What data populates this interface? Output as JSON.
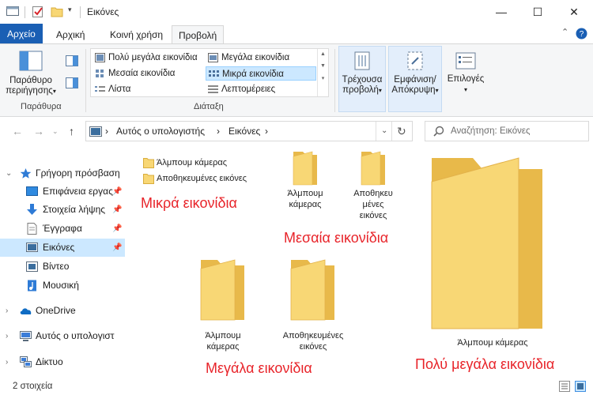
{
  "window": {
    "title": "Εικόνες",
    "minimize_glyph": "—",
    "maximize_glyph": "☐",
    "close_glyph": "✕"
  },
  "ribbon": {
    "tabs": [
      {
        "label": "Αρχείο"
      },
      {
        "label": "Αρχική"
      },
      {
        "label": "Κοινή χρήση"
      },
      {
        "label": "Προβολή"
      }
    ],
    "active_tab": "Προβολή",
    "collapse_glyph": "⌃",
    "help_glyph": "?",
    "panes": {
      "button_label_1": "Παράθυρο",
      "button_label_2": "περιήγησης",
      "group_label": "Παράθυρα"
    },
    "layout": {
      "group_label": "Διάταξη",
      "items": [
        {
          "label": "Πολύ μεγάλα εικονίδια"
        },
        {
          "label": "Μεγάλα εικονίδια"
        },
        {
          "label": "Μεσαία εικονίδια"
        },
        {
          "label": "Μικρά εικονίδια"
        },
        {
          "label": "Λίστα"
        },
        {
          "label": "Λεπτομέρειες"
        }
      ],
      "selected": "Μικρά εικονίδια"
    },
    "current_view": {
      "label_1": "Τρέχουσα",
      "label_2": "προβολή"
    },
    "show_hide": {
      "label_1": "Εμφάνιση/",
      "label_2": "Απόκρυψη"
    },
    "options": {
      "label": "Επιλογές"
    }
  },
  "address": {
    "crumbs": [
      "Αυτός ο υπολογιστής",
      "Εικόνες"
    ],
    "separator": "›",
    "search_placeholder": "Αναζήτηση: Εικόνες"
  },
  "sidebar": {
    "items": [
      {
        "label": "Γρήγορη πρόσβαση",
        "icon": "star-icon"
      },
      {
        "label": "Επιφάνεια εργας",
        "icon": "desktop-icon",
        "pinned": true
      },
      {
        "label": "Στοιχεία λήψης",
        "icon": "download-icon",
        "pinned": true
      },
      {
        "label": "Έγγραφα",
        "icon": "document-icon",
        "pinned": true
      },
      {
        "label": "Εικόνες",
        "icon": "pictures-icon",
        "pinned": true
      },
      {
        "label": "Βίντεο",
        "icon": "video-icon"
      },
      {
        "label": "Μουσική",
        "icon": "music-icon"
      },
      {
        "label": "OneDrive",
        "icon": "cloud-icon"
      },
      {
        "label": "Αυτός ο υπολογιστ",
        "icon": "computer-icon"
      },
      {
        "label": "Δίκτυο",
        "icon": "network-icon"
      }
    ],
    "selected": "Εικόνες"
  },
  "content": {
    "small_icons": [
      "Άλμπουμ κάμερας",
      "Αποθηκευμένες εικόνες"
    ],
    "medium_icons": [
      {
        "line1": "Άλμπουμ",
        "line2": "κάμερας",
        "line3": ""
      },
      {
        "line1": "Αποθηκευ",
        "line2": "μένες",
        "line3": "εικόνες"
      }
    ],
    "large_icons": [
      {
        "line1": "Άλμπουμ",
        "line2": "κάμερας"
      },
      {
        "line1": "Αποθηκευμένες",
        "line2": "εικόνες"
      }
    ],
    "extra_large_icon": "Άλμπουμ κάμερας",
    "captions": {
      "small": "Μικρά εικονίδια",
      "medium": "Μεσαία εικονίδια",
      "large": "Μεγάλα εικονίδια",
      "extra_large": "Πολύ μεγάλα εικονίδια"
    }
  },
  "status": {
    "item_count": "2 στοιχεία"
  },
  "colors": {
    "file_tab": "#1a5fb4",
    "selection": "#cce8ff",
    "folder_front": "#f8d775",
    "folder_back": "#e8b94a",
    "annotation_red": "#e8242a"
  }
}
